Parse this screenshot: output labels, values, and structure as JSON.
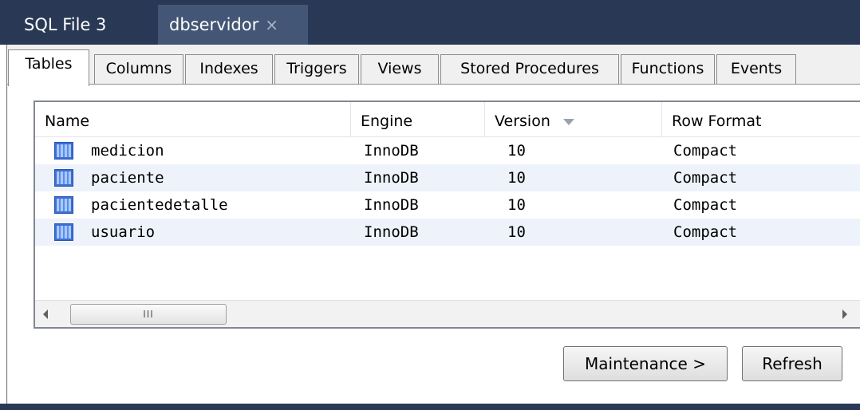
{
  "doc_tabs": [
    {
      "label": "SQL File 3"
    },
    {
      "label": "dbservidor",
      "close": "×"
    }
  ],
  "subtabs": [
    "Tables",
    "Columns",
    "Indexes",
    "Triggers",
    "Views",
    "Stored Procedures",
    "Functions",
    "Events"
  ],
  "active_subtab": "Tables",
  "grid": {
    "columns": [
      "Name",
      "Engine",
      "Version",
      "Row Format"
    ],
    "sorted_column": "Version",
    "rows": [
      {
        "name": "medicion",
        "engine": "InnoDB",
        "version": "10",
        "row_format": "Compact"
      },
      {
        "name": "paciente",
        "engine": "InnoDB",
        "version": "10",
        "row_format": "Compact"
      },
      {
        "name": "pacientedetalle",
        "engine": "InnoDB",
        "version": "10",
        "row_format": "Compact"
      },
      {
        "name": "usuario",
        "engine": "InnoDB",
        "version": "10",
        "row_format": "Compact"
      }
    ],
    "scroll_thumb": "III"
  },
  "buttons": {
    "maintenance": "Maintenance >",
    "refresh": "Refresh"
  },
  "colors": {
    "title_bar": "#293955",
    "active_doc_tab": "#435675",
    "alt_row": "#eef3fb",
    "table_icon": "#3a6fd8"
  }
}
